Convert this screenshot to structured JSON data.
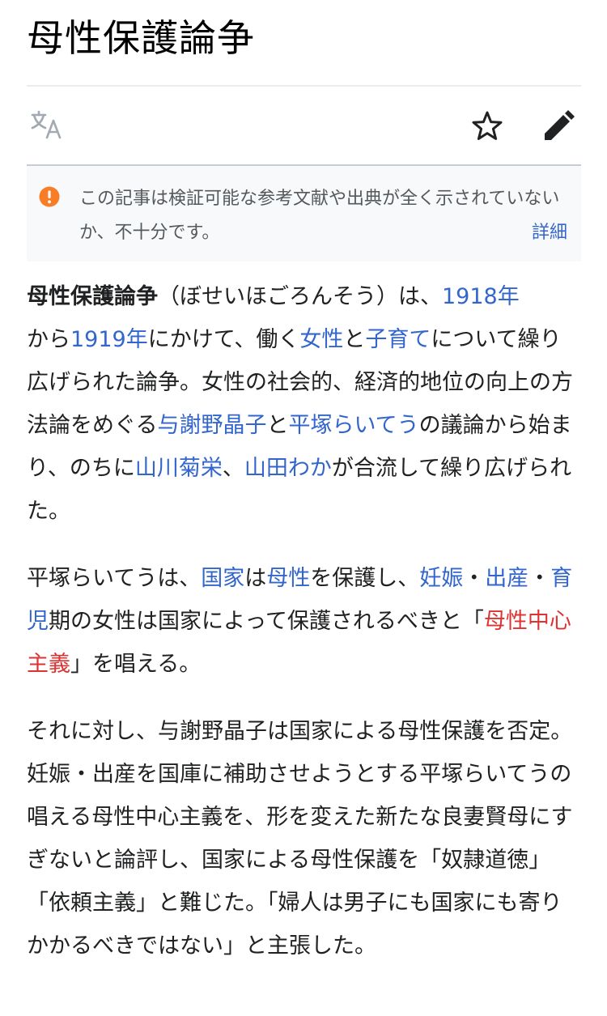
{
  "page": {
    "title": "母性保護論争"
  },
  "toolbar": {
    "language_icon": "translate-icon",
    "watch_icon": "star-icon",
    "edit_icon": "pencil-icon"
  },
  "notice": {
    "icon": "warning-circle-icon",
    "color": "#f97d27",
    "text": "この記事は検証可能な参考文献や出典が全く示されていないか、不十分です。",
    "more_label": "詳細"
  },
  "article": {
    "p1": {
      "bold_term": "母性保護論争",
      "t1": "（ぼせいほごろんそう）は、",
      "l1": "1918年",
      "t2": "から",
      "l2": "1919年",
      "t3": "にかけて、働く",
      "l3": "女性",
      "t4": "と",
      "l4": "子育て",
      "t5": "について繰り広げられた論争。女性の社会的、経済的地位の向上の方法論をめぐる",
      "l5": "与謝野晶子",
      "t6": "と",
      "l6": "平塚らいてう",
      "t7": "の議論から始まり、のちに",
      "l7": "山川菊栄",
      "t8": "、",
      "l8": "山田わか",
      "t9": "が合流して繰り広げられた。"
    },
    "p2": {
      "t1": "平塚らいてうは、",
      "l1": "国家",
      "t2": "は",
      "l2": "母性",
      "t3": "を保護し、",
      "l3": "妊娠",
      "t4": "・",
      "l4": "出産",
      "t5": "・",
      "l5": "育児",
      "t6": "期の女性は国家によって保護されるべきと「",
      "r1": "母性中心主義",
      "t7": "」を唱える。"
    },
    "p3": {
      "text": "それに対し、与謝野晶子は国家による母性保護を否定。妊娠・出産を国庫に補助させようとする平塚らいてうの唱える母性中心主義を、形を変えた新たな良妻賢母にすぎないと論評し、国家による母性保護を「奴隷道徳」「依頼主義」と難じた。「婦人は男子にも国家にも寄りかかるべきではない」と主張した。"
    }
  }
}
